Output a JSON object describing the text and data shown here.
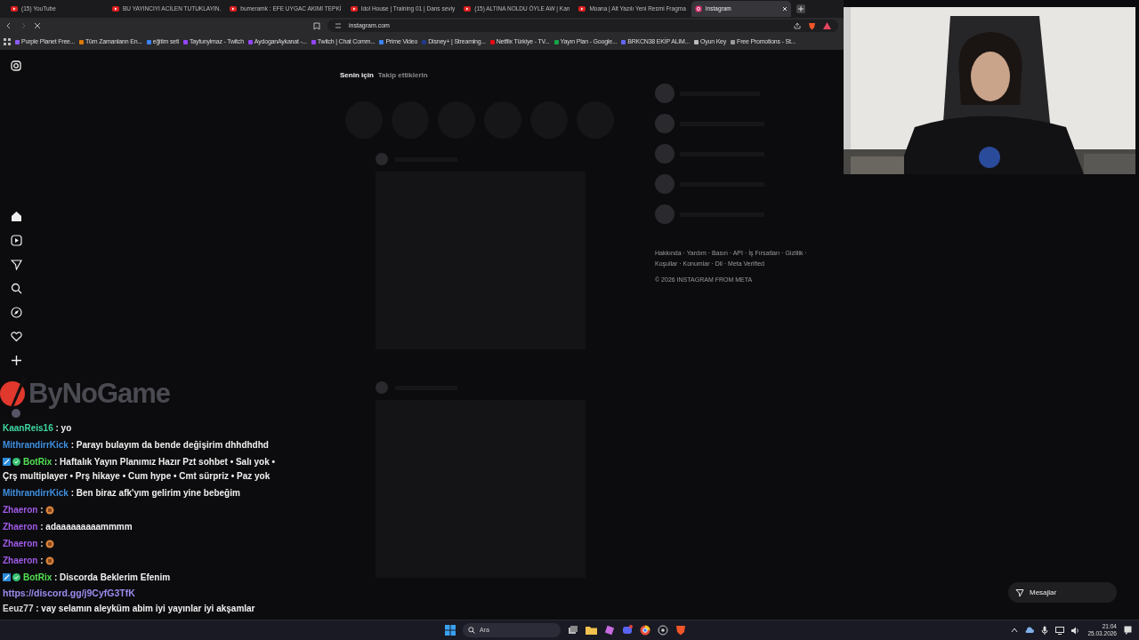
{
  "browser": {
    "tabs": [
      {
        "title": "(15) YouTube",
        "kind": "youtube",
        "selected": false
      },
      {
        "title": "BU YAYINCIYI ACİLEN TUTUKLAYIN.",
        "kind": "youtube",
        "selected": false
      },
      {
        "title": "bumeramk : EFE UYGAC AKIMI TEPKİ",
        "kind": "youtube",
        "selected": false
      },
      {
        "title": "Idol House | Training 01 | Dans seviy",
        "kind": "youtube",
        "selected": false
      },
      {
        "title": "(15) ALTINA NOLDU ÖYLE AW | Kan",
        "kind": "youtube",
        "selected": false
      },
      {
        "title": "Moana | Alt Yazılı Yeni Resmi Fragma",
        "kind": "youtube",
        "selected": false
      },
      {
        "title": "Instagram",
        "kind": "instagram",
        "selected": true
      }
    ],
    "address": "instagram.com",
    "bookmarks": [
      "Purple Planet Free...",
      "Tüm Zamanların En...",
      "eğitim seti",
      "Tayfunylmaz - Twitch",
      "AydoganAykanat -...",
      "Twitch | Chat Comm...",
      "Prime Video",
      "Disney+ | Streaming...",
      "Netflix Türkiye - TV...",
      "Yayın Plan - Google...",
      "BRKCN38 EKİP ALIM...",
      "Oyun Key",
      "Free Promotions - St..."
    ]
  },
  "instagram": {
    "feed_tabs": [
      {
        "label": "Senin için",
        "selected": true
      },
      {
        "label": "Takip ettiklerin",
        "selected": false
      }
    ],
    "footer_links": [
      "Hakkında · Yardım · Basın · API · İş Fırsatları · Gizlilik ·",
      "Koşullar · Konumlar · Dil · Meta Verified"
    ],
    "copyright": "© 2026 INSTAGRAM FROM META",
    "messages_button": "Mesajlar"
  },
  "stream_overlay": {
    "logo": "ByNoGame",
    "chat": [
      {
        "kind": "text",
        "user": "KaanReis16",
        "color": "#3fd8a0",
        "badges": false,
        "text": ": yo"
      },
      {
        "kind": "text",
        "user": "MithrandirrKick",
        "color": "#3f8fe0",
        "badges": false,
        "text": ": Parayı bulayım da bende değişirim dhhdhdhd"
      },
      {
        "kind": "text",
        "user": "BotRix",
        "color": "#53e052",
        "badges": true,
        "text": ": Haftalık Yayın Planımız Hazır Pzt sohbet • Salı yok • Çrş multiplayer • Prş hikaye • Cum hype • Cmt sürpriz • Paz yok"
      },
      {
        "kind": "text",
        "user": "MithrandirrKick",
        "color": "#3f8fe0",
        "badges": false,
        "text": ": Ben biraz afk'yım gelirim yine bebeğim"
      },
      {
        "kind": "emote",
        "user": "Zhaeron",
        "color": "#a05ae8",
        "badges": false,
        "text": ":"
      },
      {
        "kind": "text",
        "user": "Zhaeron",
        "color": "#a05ae8",
        "badges": false,
        "text": ": adaaaaaaaaammmm"
      },
      {
        "kind": "emote",
        "user": "Zhaeron",
        "color": "#a05ae8",
        "badges": false,
        "text": ":"
      },
      {
        "kind": "emote",
        "user": "Zhaeron",
        "color": "#a05ae8",
        "badges": false,
        "text": ":"
      },
      {
        "kind": "text",
        "user": "BotRix",
        "color": "#53e052",
        "badges": true,
        "text": ": Discorda Beklerim Efenim"
      },
      {
        "kind": "link",
        "text": "https://discord.gg/j9CyfG3TfK"
      },
      {
        "kind": "text",
        "user": "Eeuz77",
        "color": "#d8d8d8",
        "badges": false,
        "text": ": vay selamın aleyküm abim iyi yayınlar iyi akşamlar"
      }
    ]
  },
  "taskbar": {
    "search_placeholder": "Ara",
    "time": "21:04",
    "date": "25.03.2026"
  }
}
